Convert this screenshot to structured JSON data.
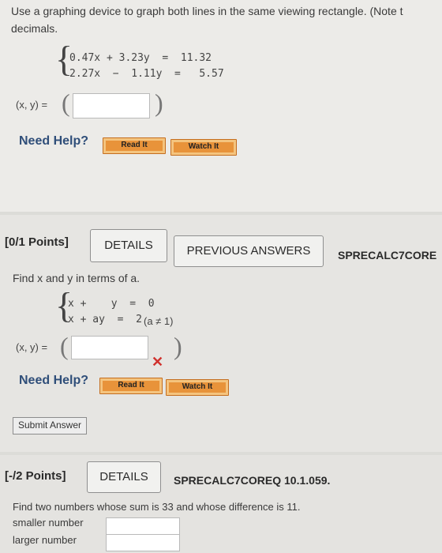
{
  "q1": {
    "prompt_line1": "Use a graphing device to graph both lines in the same viewing rectangle. (Note t",
    "prompt_line2": "decimals.",
    "eq1": "0.47x + 3.23y  =  11.32",
    "eq2": "2.27x  −  1.11y  =   5.57",
    "answer_label": "(x, y) =",
    "answer_value": "",
    "need_help": "Need Help?",
    "read_it": "Read It",
    "watch_it": "Watch It"
  },
  "q2": {
    "points": "[0/1 Points]",
    "details": "DETAILS",
    "previous_answers": "PREVIOUS ANSWERS",
    "course": "SPRECALC7CORE",
    "prompt": "Find x and y in terms of a.",
    "eq1": "x +    y  =  0",
    "eq2": "x + ay  =  2",
    "condition": "(a ≠ 1)",
    "answer_label": "(x, y) =",
    "answer_value": "",
    "incorrect_mark": "✕",
    "need_help": "Need Help?",
    "read_it": "Read It",
    "watch_it": "Watch It",
    "submit": "Submit Answer"
  },
  "q3": {
    "points": "[-/2 Points]",
    "details": "DETAILS",
    "course": "SPRECALC7COREQ 10.1.059.",
    "prompt": "Find two numbers whose sum is 33 and whose difference is 11.",
    "smaller_label": "smaller number",
    "larger_label": "larger number",
    "smaller_value": "",
    "larger_value": ""
  },
  "colors": {
    "accent_orange": "#e8933a",
    "help_blue": "#2f4e79",
    "incorrect_red": "#d0312d"
  }
}
